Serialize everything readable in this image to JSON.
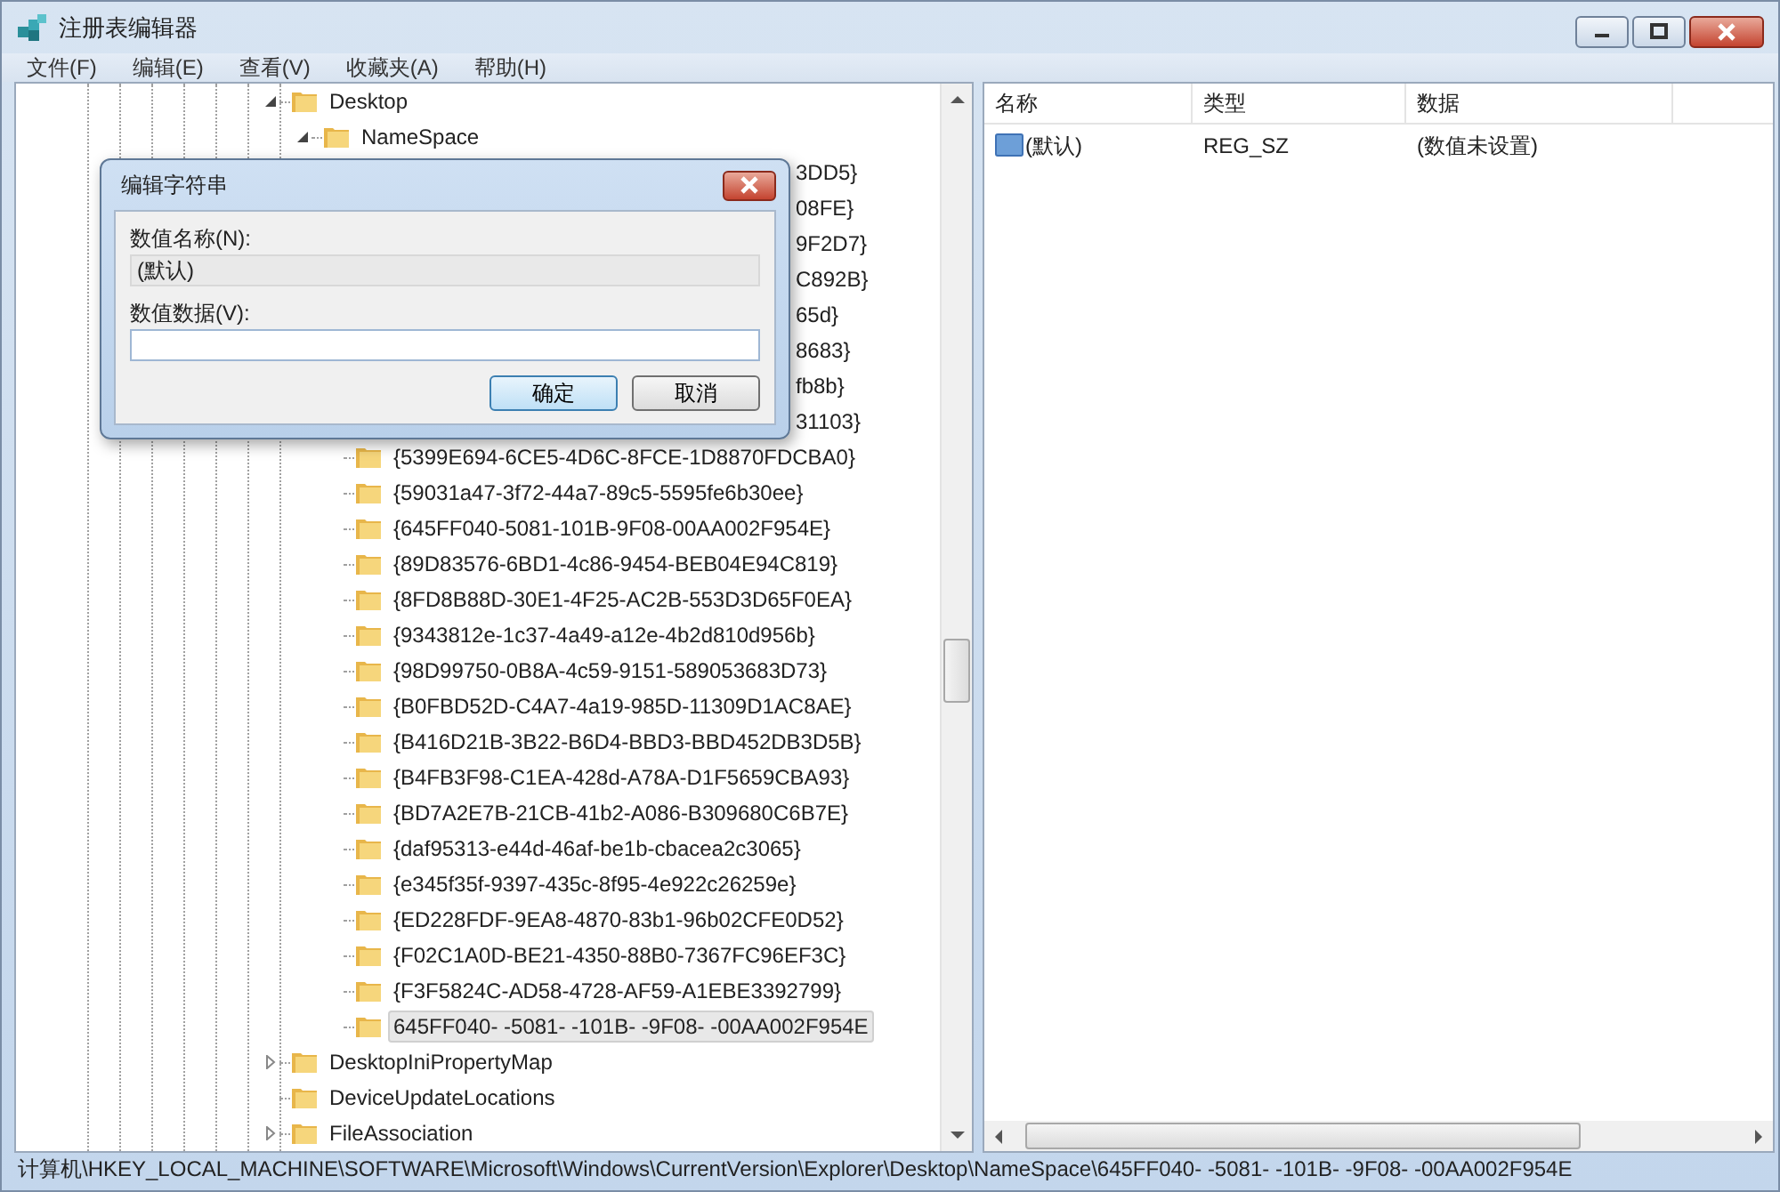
{
  "window": {
    "title": "注册表编辑器"
  },
  "menu": [
    {
      "label": "文件(F)"
    },
    {
      "label": "编辑(E)"
    },
    {
      "label": "查看(V)"
    },
    {
      "label": "收藏夹(A)"
    },
    {
      "label": "帮助(H)"
    }
  ],
  "tree": {
    "items": [
      {
        "label": "Desktop",
        "kind": "branch",
        "expanded": true,
        "selected": false,
        "children": [
          {
            "label": "NameSpace",
            "kind": "branch",
            "expanded": true,
            "selected": false,
            "children": [
              {
                "label": "3DD5}",
                "kind": "partial",
                "selected": false
              },
              {
                "label": "08FE}",
                "kind": "partial",
                "selected": false
              },
              {
                "label": "9F2D7}",
                "kind": "partial",
                "selected": false
              },
              {
                "label": "C892B}",
                "kind": "partial",
                "selected": false
              },
              {
                "label": "65d}",
                "kind": "partial",
                "selected": false
              },
              {
                "label": "8683}",
                "kind": "partial",
                "selected": false
              },
              {
                "label": "fb8b}",
                "kind": "partial",
                "selected": false
              },
              {
                "label": "31103}",
                "kind": "partial",
                "selected": false
              },
              {
                "label": "{5399E694-6CE5-4D6C-8FCE-1D8870FDCBA0}",
                "kind": "leaf",
                "selected": false
              },
              {
                "label": "{59031a47-3f72-44a7-89c5-5595fe6b30ee}",
                "kind": "leaf",
                "selected": false
              },
              {
                "label": "{645FF040-5081-101B-9F08-00AA002F954E}",
                "kind": "leaf",
                "selected": false
              },
              {
                "label": "{89D83576-6BD1-4c86-9454-BEB04E94C819}",
                "kind": "leaf",
                "selected": false
              },
              {
                "label": "{8FD8B88D-30E1-4F25-AC2B-553D3D65F0EA}",
                "kind": "leaf",
                "selected": false
              },
              {
                "label": "{9343812e-1c37-4a49-a12e-4b2d810d956b}",
                "kind": "leaf",
                "selected": false
              },
              {
                "label": "{98D99750-0B8A-4c59-9151-589053683D73}",
                "kind": "leaf",
                "selected": false
              },
              {
                "label": "{B0FBD52D-C4A7-4a19-985D-11309D1AC8AE}",
                "kind": "leaf",
                "selected": false
              },
              {
                "label": "{B416D21B-3B22-B6D4-BBD3-BBD452DB3D5B}",
                "kind": "leaf",
                "selected": false
              },
              {
                "label": "{B4FB3F98-C1EA-428d-A78A-D1F5659CBA93}",
                "kind": "leaf",
                "selected": false
              },
              {
                "label": "{BD7A2E7B-21CB-41b2-A086-B309680C6B7E}",
                "kind": "leaf",
                "selected": false
              },
              {
                "label": "{daf95313-e44d-46af-be1b-cbacea2c3065}",
                "kind": "leaf",
                "selected": false
              },
              {
                "label": "{e345f35f-9397-435c-8f95-4e922c26259e}",
                "kind": "leaf",
                "selected": false
              },
              {
                "label": "{ED228FDF-9EA8-4870-83b1-96b02CFE0D52}",
                "kind": "leaf",
                "selected": false
              },
              {
                "label": "{F02C1A0D-BE21-4350-88B0-7367FC96EF3C}",
                "kind": "leaf",
                "selected": false
              },
              {
                "label": "{F3F5824C-AD58-4728-AF59-A1EBE3392799}",
                "kind": "leaf",
                "selected": false
              },
              {
                "label": "645FF040- -5081- -101B- -9F08- -00AA002F954E",
                "kind": "leaf",
                "selected": true
              }
            ]
          }
        ]
      },
      {
        "label": "DesktopIniPropertyMap",
        "kind": "branch",
        "expanded": false,
        "selected": false
      },
      {
        "label": "DeviceUpdateLocations",
        "kind": "leaf",
        "selected": false
      },
      {
        "label": "FileAssociation",
        "kind": "branch",
        "expanded": false,
        "selected": false
      }
    ]
  },
  "values": {
    "columns": [
      "名称",
      "类型",
      "数据"
    ],
    "rows": [
      {
        "name": "(默认)",
        "type": "REG_SZ",
        "data": "(数值未设置)"
      }
    ]
  },
  "dialog": {
    "title": "编辑字符串",
    "name_label": "数值名称(N):",
    "name_value": "(默认)",
    "data_label": "数值数据(V):",
    "buttons": [
      {
        "label": "确定",
        "default": true
      },
      {
        "label": "取消",
        "default": false
      }
    ]
  },
  "status_bar": "计算机\\HKEY_LOCAL_MACHINE\\SOFTWARE\\Microsoft\\Windows\\CurrentVersion\\Explorer\\Desktop\\NameSpace\\645FF040- -5081- -101B- -9F08- -00AA002F954E"
}
